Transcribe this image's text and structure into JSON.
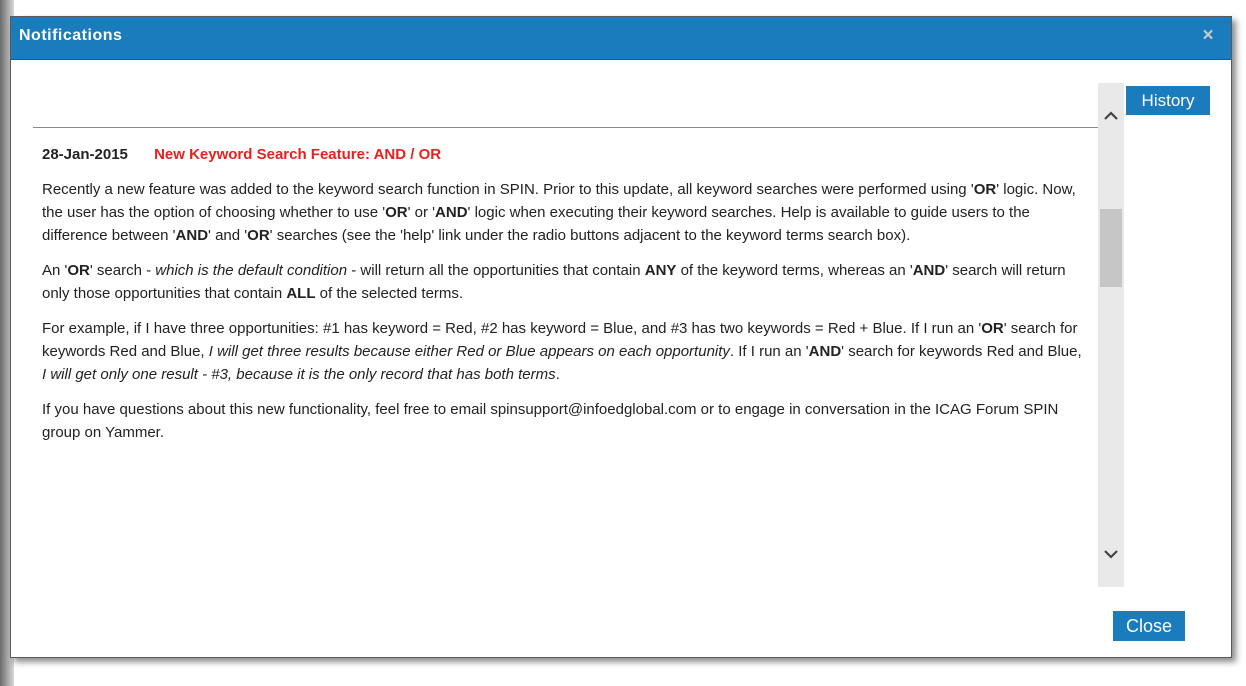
{
  "dialog": {
    "title": "Notifications",
    "close_glyph": "×",
    "history_label": "History",
    "close_label": "Close"
  },
  "notice": {
    "date": "28-Jan-2015",
    "title": "New Keyword Search Feature: AND / OR",
    "p1": "Recently a new feature was added to the keyword search function in SPIN. Prior to this update, all keyword searches were performed using 'OR' logic. Now, the user has the option of choosing whether to use 'OR' or 'AND' logic when executing their keyword searches. Help is available to guide users to the difference between 'AND' and 'OR' searches (see the 'help' link under the radio buttons adjacent to the keyword terms search box).",
    "p2": {
      "a": "An '",
      "b": "OR",
      "c": "' search - ",
      "d": "which is the default condition",
      "e": " - will return all the opportunities that contain ",
      "f": "ANY",
      "g": " of the keyword terms, whereas an '",
      "h": "AND",
      "i": "' search will return only those opportunities that contain ",
      "j": "ALL",
      "k": " of the selected terms."
    },
    "p3": {
      "a": "For example, if I have three opportunities: #1 has keyword = Red, #2 has keyword = Blue, and #3 has two keywords = Red + Blue. If I run an '",
      "b": "OR",
      "c": "' search for keywords Red and Blue, ",
      "d": "I will get three results because either Red or Blue appears on each opportunity",
      "e": ". If I run an '",
      "f": "AND",
      "g": "' search for keywords Red and Blue, ",
      "h": "I will get only one result - #3, because it is the only record that has both terms",
      "i": "."
    },
    "p4": "If you have questions about this new functionality, feel free to email spinsupport@infoedglobal.com or to engage in conversation in the ICAG Forum SPIN group on Yammer."
  },
  "icons": {
    "scroll_up": "^",
    "scroll_down": "v"
  },
  "colors": {
    "titlebar": "#1a7bbd",
    "notice_title": "#e8201f",
    "button": "#1a7bbd"
  }
}
